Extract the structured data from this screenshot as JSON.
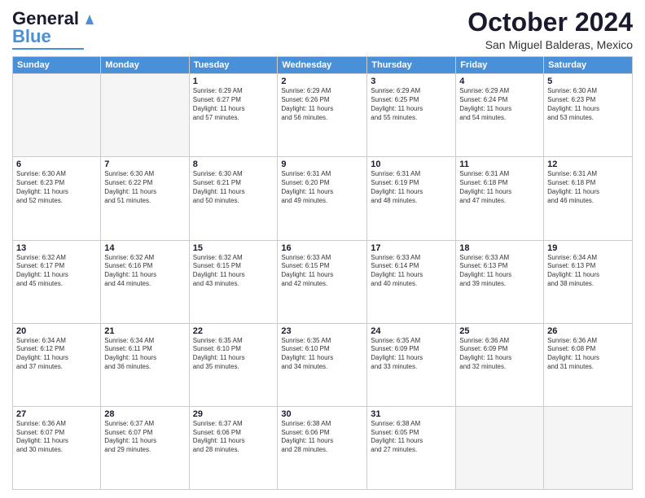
{
  "header": {
    "logo_line1": "General",
    "logo_line2": "Blue",
    "title": "October 2024",
    "subtitle": "San Miguel Balderas, Mexico"
  },
  "days_of_week": [
    "Sunday",
    "Monday",
    "Tuesday",
    "Wednesday",
    "Thursday",
    "Friday",
    "Saturday"
  ],
  "weeks": [
    [
      {
        "day": "",
        "info": ""
      },
      {
        "day": "",
        "info": ""
      },
      {
        "day": "1",
        "info": "Sunrise: 6:29 AM\nSunset: 6:27 PM\nDaylight: 11 hours\nand 57 minutes."
      },
      {
        "day": "2",
        "info": "Sunrise: 6:29 AM\nSunset: 6:26 PM\nDaylight: 11 hours\nand 56 minutes."
      },
      {
        "day": "3",
        "info": "Sunrise: 6:29 AM\nSunset: 6:25 PM\nDaylight: 11 hours\nand 55 minutes."
      },
      {
        "day": "4",
        "info": "Sunrise: 6:29 AM\nSunset: 6:24 PM\nDaylight: 11 hours\nand 54 minutes."
      },
      {
        "day": "5",
        "info": "Sunrise: 6:30 AM\nSunset: 6:23 PM\nDaylight: 11 hours\nand 53 minutes."
      }
    ],
    [
      {
        "day": "6",
        "info": "Sunrise: 6:30 AM\nSunset: 6:23 PM\nDaylight: 11 hours\nand 52 minutes."
      },
      {
        "day": "7",
        "info": "Sunrise: 6:30 AM\nSunset: 6:22 PM\nDaylight: 11 hours\nand 51 minutes."
      },
      {
        "day": "8",
        "info": "Sunrise: 6:30 AM\nSunset: 6:21 PM\nDaylight: 11 hours\nand 50 minutes."
      },
      {
        "day": "9",
        "info": "Sunrise: 6:31 AM\nSunset: 6:20 PM\nDaylight: 11 hours\nand 49 minutes."
      },
      {
        "day": "10",
        "info": "Sunrise: 6:31 AM\nSunset: 6:19 PM\nDaylight: 11 hours\nand 48 minutes."
      },
      {
        "day": "11",
        "info": "Sunrise: 6:31 AM\nSunset: 6:18 PM\nDaylight: 11 hours\nand 47 minutes."
      },
      {
        "day": "12",
        "info": "Sunrise: 6:31 AM\nSunset: 6:18 PM\nDaylight: 11 hours\nand 46 minutes."
      }
    ],
    [
      {
        "day": "13",
        "info": "Sunrise: 6:32 AM\nSunset: 6:17 PM\nDaylight: 11 hours\nand 45 minutes."
      },
      {
        "day": "14",
        "info": "Sunrise: 6:32 AM\nSunset: 6:16 PM\nDaylight: 11 hours\nand 44 minutes."
      },
      {
        "day": "15",
        "info": "Sunrise: 6:32 AM\nSunset: 6:15 PM\nDaylight: 11 hours\nand 43 minutes."
      },
      {
        "day": "16",
        "info": "Sunrise: 6:33 AM\nSunset: 6:15 PM\nDaylight: 11 hours\nand 42 minutes."
      },
      {
        "day": "17",
        "info": "Sunrise: 6:33 AM\nSunset: 6:14 PM\nDaylight: 11 hours\nand 40 minutes."
      },
      {
        "day": "18",
        "info": "Sunrise: 6:33 AM\nSunset: 6:13 PM\nDaylight: 11 hours\nand 39 minutes."
      },
      {
        "day": "19",
        "info": "Sunrise: 6:34 AM\nSunset: 6:13 PM\nDaylight: 11 hours\nand 38 minutes."
      }
    ],
    [
      {
        "day": "20",
        "info": "Sunrise: 6:34 AM\nSunset: 6:12 PM\nDaylight: 11 hours\nand 37 minutes."
      },
      {
        "day": "21",
        "info": "Sunrise: 6:34 AM\nSunset: 6:11 PM\nDaylight: 11 hours\nand 36 minutes."
      },
      {
        "day": "22",
        "info": "Sunrise: 6:35 AM\nSunset: 6:10 PM\nDaylight: 11 hours\nand 35 minutes."
      },
      {
        "day": "23",
        "info": "Sunrise: 6:35 AM\nSunset: 6:10 PM\nDaylight: 11 hours\nand 34 minutes."
      },
      {
        "day": "24",
        "info": "Sunrise: 6:35 AM\nSunset: 6:09 PM\nDaylight: 11 hours\nand 33 minutes."
      },
      {
        "day": "25",
        "info": "Sunrise: 6:36 AM\nSunset: 6:09 PM\nDaylight: 11 hours\nand 32 minutes."
      },
      {
        "day": "26",
        "info": "Sunrise: 6:36 AM\nSunset: 6:08 PM\nDaylight: 11 hours\nand 31 minutes."
      }
    ],
    [
      {
        "day": "27",
        "info": "Sunrise: 6:36 AM\nSunset: 6:07 PM\nDaylight: 11 hours\nand 30 minutes."
      },
      {
        "day": "28",
        "info": "Sunrise: 6:37 AM\nSunset: 6:07 PM\nDaylight: 11 hours\nand 29 minutes."
      },
      {
        "day": "29",
        "info": "Sunrise: 6:37 AM\nSunset: 6:06 PM\nDaylight: 11 hours\nand 28 minutes."
      },
      {
        "day": "30",
        "info": "Sunrise: 6:38 AM\nSunset: 6:06 PM\nDaylight: 11 hours\nand 28 minutes."
      },
      {
        "day": "31",
        "info": "Sunrise: 6:38 AM\nSunset: 6:05 PM\nDaylight: 11 hours\nand 27 minutes."
      },
      {
        "day": "",
        "info": ""
      },
      {
        "day": "",
        "info": ""
      }
    ]
  ]
}
